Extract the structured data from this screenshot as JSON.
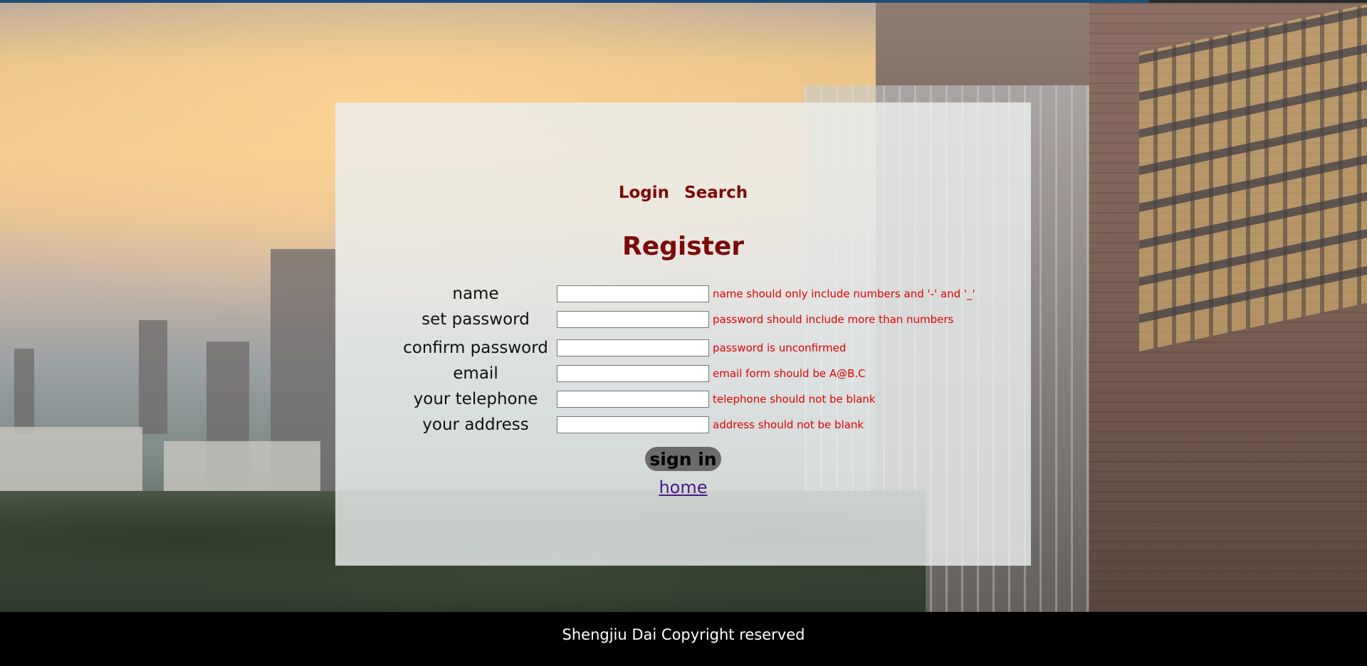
{
  "nav": {
    "login_label": "Login",
    "search_label": "Search"
  },
  "page_title": "Register",
  "form": {
    "fields": [
      {
        "label": "name",
        "value": "",
        "hint": "name should only include numbers and '-' and '_'"
      },
      {
        "label": "set password",
        "value": "",
        "hint": "password should include more than numbers"
      },
      {
        "label": "confirm password",
        "value": "",
        "hint": "password is unconfirmed"
      },
      {
        "label": "email",
        "value": "",
        "hint": "email form should be A@B.C"
      },
      {
        "label": "your telephone",
        "value": "",
        "hint": "telephone should not be blank"
      },
      {
        "label": "your address",
        "value": "",
        "hint": "address should not be blank"
      }
    ],
    "submit_label": "sign in"
  },
  "home_link": "home",
  "footer": {
    "text": "Shengjiu Dai Copyright reserved"
  },
  "colors": {
    "accent_dark_red": "#7b0a0a",
    "hint_red": "#e00000",
    "link_purple": "#4b1a8a",
    "footer_bg": "#000000"
  }
}
